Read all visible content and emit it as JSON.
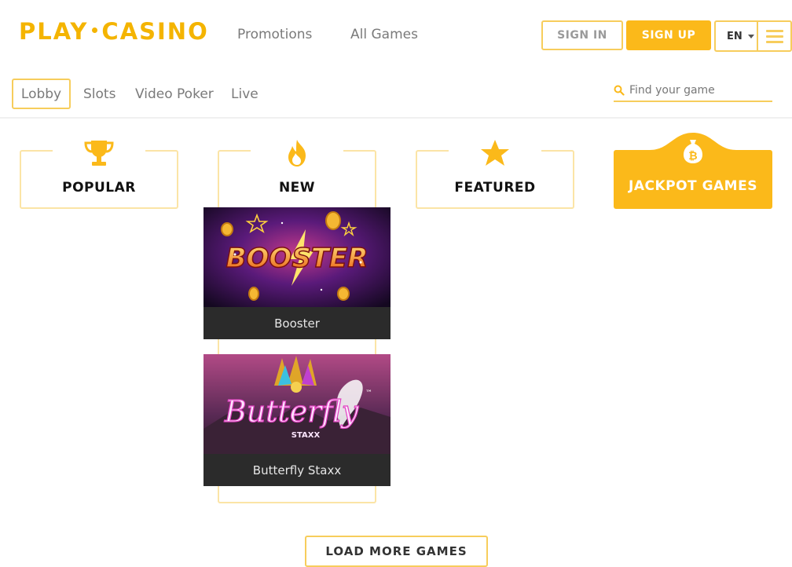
{
  "header": {
    "logo_left": "PLAY",
    "logo_right": "CASINO",
    "nav": [
      "Promotions",
      "All Games"
    ],
    "sign_in": "SIGN IN",
    "sign_up": "SIGN UP",
    "language": "EN"
  },
  "subnav": {
    "tabs": [
      "Lobby",
      "Slots",
      "Video Poker",
      "Live"
    ],
    "active_tab": "Lobby",
    "search_placeholder": "Find your game"
  },
  "categories": [
    {
      "label": "POPULAR",
      "icon": "trophy-icon"
    },
    {
      "label": "NEW",
      "icon": "fire-icon"
    },
    {
      "label": "FEATURED",
      "icon": "star-icon"
    },
    {
      "label": "JACKPOT GAMES",
      "icon": "money-bag-icon"
    }
  ],
  "games": [
    {
      "title": "Booster",
      "art_text": "BOOSTER"
    },
    {
      "title": "Butterfly Staxx",
      "art_text": "Butterfly",
      "art_sub": "STAXX"
    }
  ],
  "load_more": "LOAD MORE GAMES",
  "colors": {
    "accent": "#fbb91a",
    "accent_light": "#f7cd5c",
    "text": "#7a7a7a"
  }
}
